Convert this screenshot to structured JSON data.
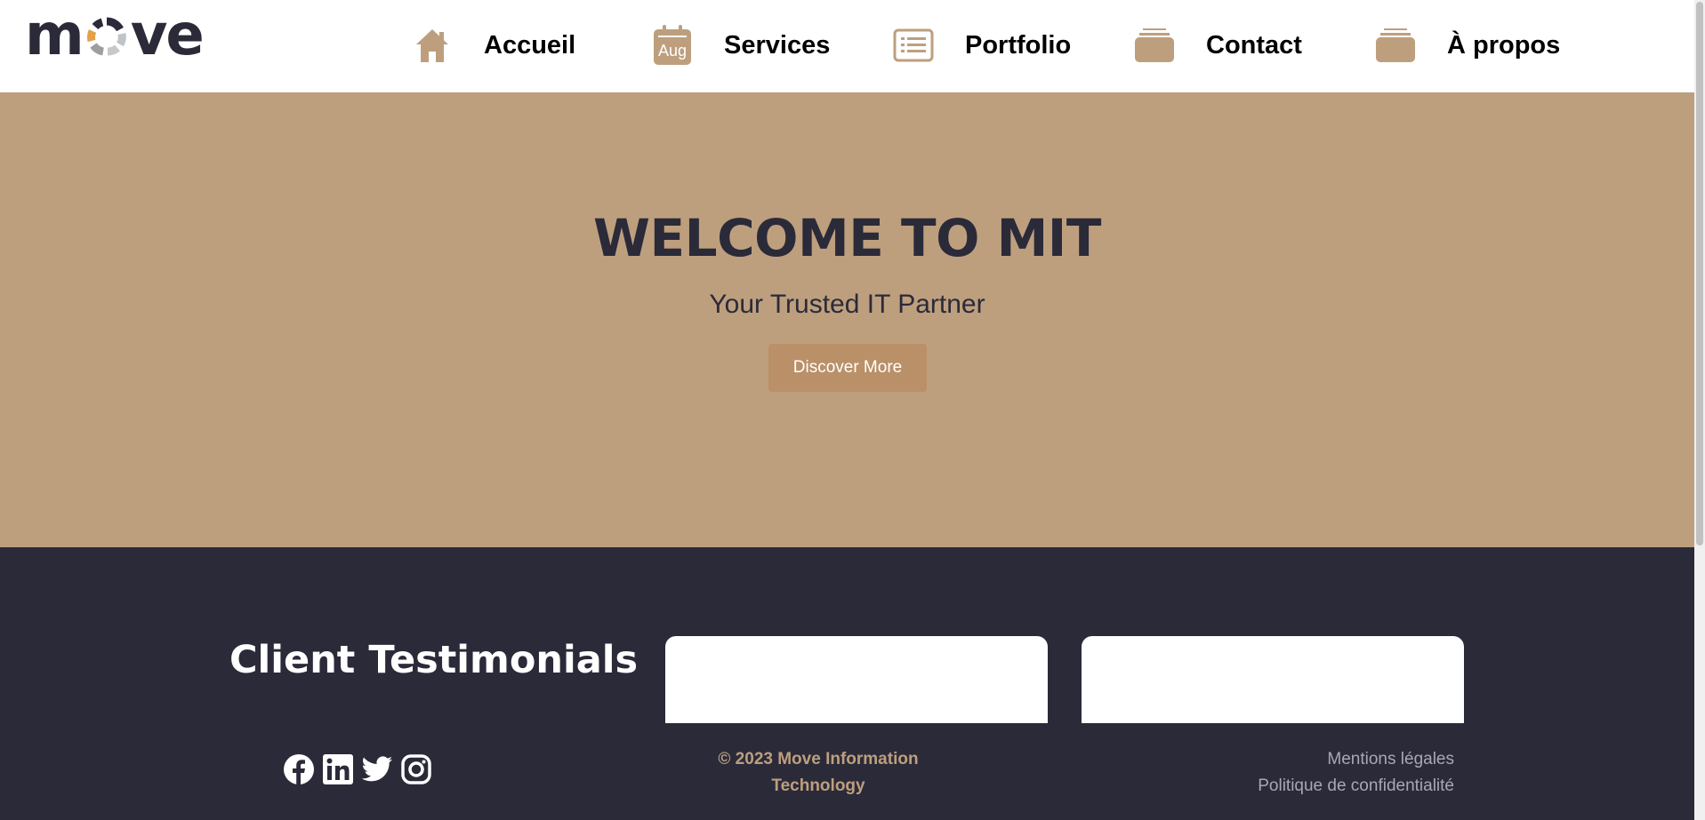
{
  "logo": {
    "text_before": "m",
    "text_after": "ve",
    "icon": "segmented-ring-o"
  },
  "nav": {
    "items": [
      {
        "label": "Accueil",
        "icon": "home-icon"
      },
      {
        "label": "Services",
        "icon": "calendar-icon",
        "icon_text": "Aug"
      },
      {
        "label": "Portfolio",
        "icon": "list-icon"
      },
      {
        "label": "Contact",
        "icon": "folder-icon"
      },
      {
        "label": "À propos",
        "icon": "folder-icon"
      }
    ]
  },
  "hero": {
    "title": "WELCOME TO MIT",
    "subtitle": "Your Trusted IT Partner",
    "button_label": "Discover More"
  },
  "testimonials": {
    "title": "Client Testimonials"
  },
  "footer": {
    "social": [
      "facebook-icon",
      "linkedin-icon",
      "twitter-icon",
      "instagram-icon"
    ],
    "copyright_line1": "© 2023 Move Information",
    "copyright_line2": "Technology",
    "links": [
      "Mentions légales",
      "Politique de confidentialité"
    ]
  },
  "colors": {
    "brand_tan": "#bd9f7e",
    "button": "#b99068",
    "dark": "#2b2a39",
    "white": "#ffffff"
  }
}
